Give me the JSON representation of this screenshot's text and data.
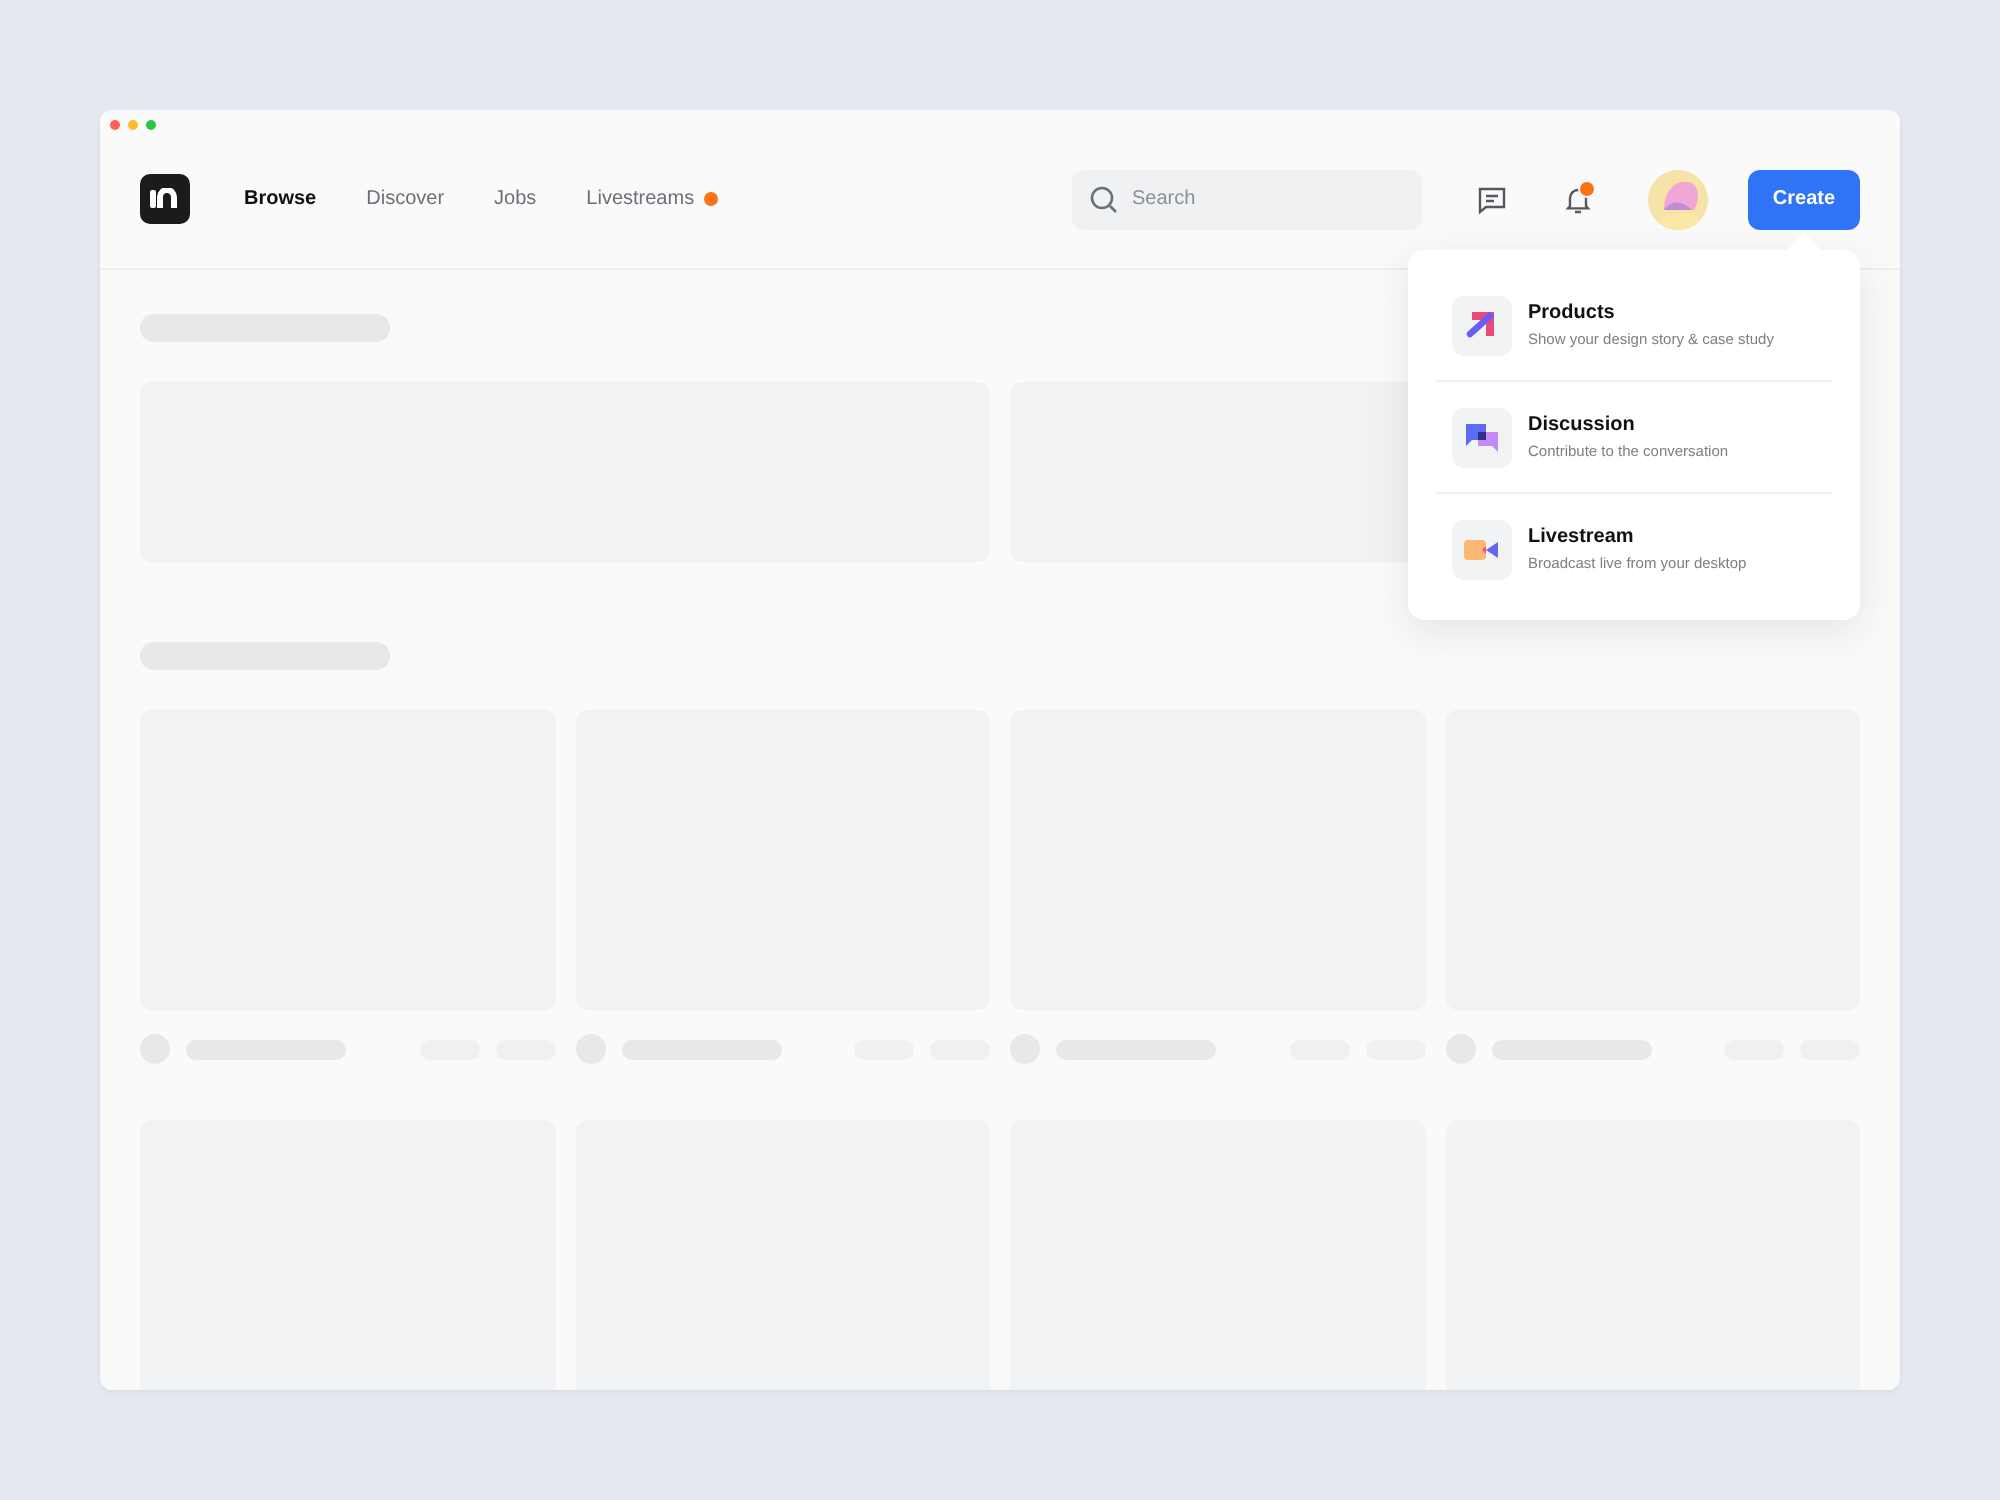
{
  "nav": [
    {
      "label": "Browse",
      "selected": true,
      "live_dot": false
    },
    {
      "label": "Discover",
      "selected": false,
      "live_dot": false
    },
    {
      "label": "Jobs",
      "selected": false,
      "live_dot": false
    },
    {
      "label": "Livestreams",
      "selected": false,
      "live_dot": true
    }
  ],
  "search": {
    "placeholder": "Search"
  },
  "notifications": {
    "unread": true
  },
  "create_button": "Create",
  "create_menu": [
    {
      "kind": "products",
      "title": "Products",
      "subtitle": "Show your design story & case study"
    },
    {
      "kind": "discussion",
      "title": "Discussion",
      "subtitle": "Contribute to the conversation"
    },
    {
      "kind": "livestream",
      "title": "Livestream",
      "subtitle": "Broadcast live from your desktop"
    }
  ]
}
